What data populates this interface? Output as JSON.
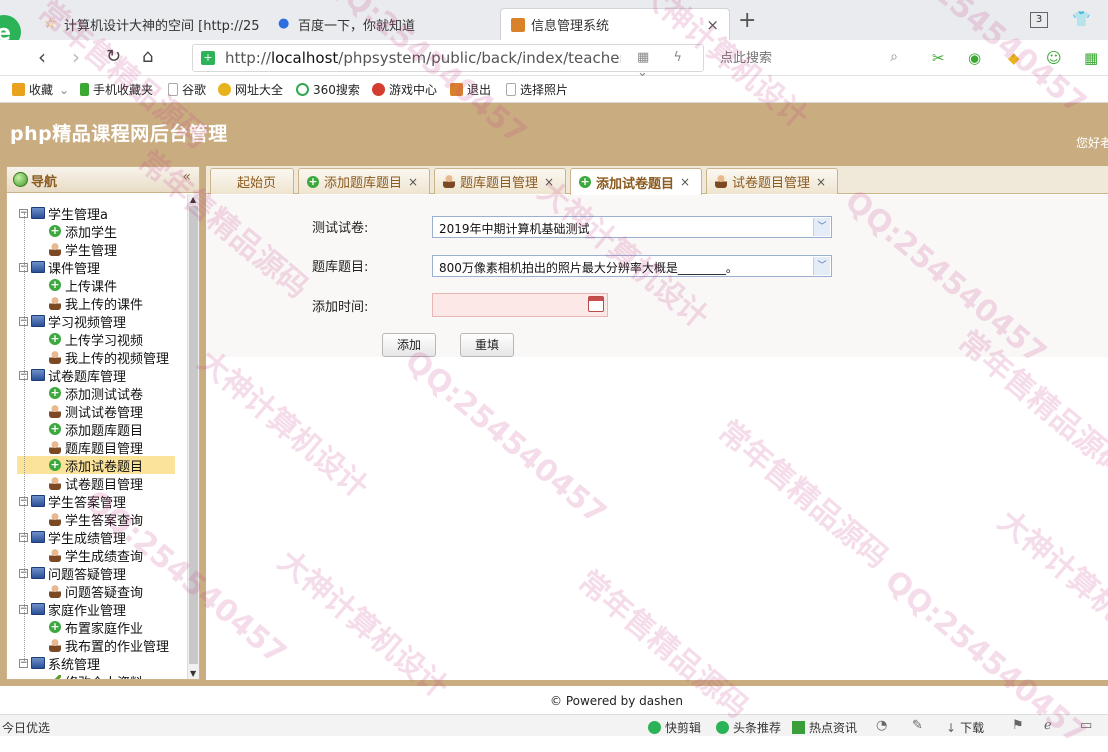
{
  "browser": {
    "tabs": [
      {
        "title": "计算机设计大神的空间 [http://25"
      },
      {
        "title": "百度一下，你就知道"
      },
      {
        "title": "信息管理系统"
      }
    ],
    "tab_count": "3",
    "url_prefix": "http://",
    "url_host": "localhost",
    "url_path": "/phpsystem/public/back/index/teacherinde",
    "search_placeholder": "点此搜索"
  },
  "bookmarks": [
    {
      "label": "收藏",
      "color": "#e8a21d"
    },
    {
      "label": "手机收藏夹",
      "color": "#3aa832"
    },
    {
      "label": "谷歌",
      "color": "#bbbbbb"
    },
    {
      "label": "网址大全",
      "color": "#e8b21d"
    },
    {
      "label": "360搜索",
      "color": "#33a852"
    },
    {
      "label": "游戏中心",
      "color": "#d33c2f"
    },
    {
      "label": "退出",
      "color": "#d9822b"
    },
    {
      "label": "选择照片",
      "color": "#bbbbbb"
    }
  ],
  "app": {
    "title": "php精品课程网后台管理",
    "greeting": "您好老",
    "footer": "© Powered by dashen"
  },
  "sidebar": {
    "title": "导航",
    "tree": [
      {
        "label": "学生管理a",
        "level": 0
      },
      {
        "label": "添加学生",
        "level": 1,
        "icon": "plus"
      },
      {
        "label": "学生管理",
        "level": 1,
        "icon": "user"
      },
      {
        "label": "课件管理",
        "level": 0
      },
      {
        "label": "上传课件",
        "level": 1,
        "icon": "plus"
      },
      {
        "label": "我上传的课件",
        "level": 1,
        "icon": "user"
      },
      {
        "label": "学习视频管理",
        "level": 0
      },
      {
        "label": "上传学习视频",
        "level": 1,
        "icon": "plus"
      },
      {
        "label": "我上传的视频管理",
        "level": 1,
        "icon": "user"
      },
      {
        "label": "试卷题库管理",
        "level": 0
      },
      {
        "label": "添加测试试卷",
        "level": 1,
        "icon": "plus"
      },
      {
        "label": "测试试卷管理",
        "level": 1,
        "icon": "user"
      },
      {
        "label": "添加题库题目",
        "level": 1,
        "icon": "plus"
      },
      {
        "label": "题库题目管理",
        "level": 1,
        "icon": "user"
      },
      {
        "label": "添加试卷题目",
        "level": 1,
        "icon": "plus",
        "selected": true
      },
      {
        "label": "试卷题目管理",
        "level": 1,
        "icon": "user"
      },
      {
        "label": "学生答案管理",
        "level": 0
      },
      {
        "label": "学生答案查询",
        "level": 1,
        "icon": "user"
      },
      {
        "label": "学生成绩管理",
        "level": 0
      },
      {
        "label": "学生成绩查询",
        "level": 1,
        "icon": "user"
      },
      {
        "label": "问题答疑管理",
        "level": 0
      },
      {
        "label": "问题答疑查询",
        "level": 1,
        "icon": "user"
      },
      {
        "label": "家庭作业管理",
        "level": 0
      },
      {
        "label": "布置家庭作业",
        "level": 1,
        "icon": "plus"
      },
      {
        "label": "我布置的作业管理",
        "level": 1,
        "icon": "user"
      },
      {
        "label": "系统管理",
        "level": 0
      },
      {
        "label": "修改个人资料",
        "level": 1,
        "icon": "pen"
      }
    ]
  },
  "content_tabs": [
    {
      "label": "起始页",
      "closable": false,
      "icon": "none"
    },
    {
      "label": "添加题库题目",
      "closable": true,
      "icon": "plus"
    },
    {
      "label": "题库题目管理",
      "closable": true,
      "icon": "user"
    },
    {
      "label": "添加试卷题目",
      "closable": true,
      "icon": "plus",
      "active": true
    },
    {
      "label": "试卷题目管理",
      "closable": true,
      "icon": "user"
    }
  ],
  "form": {
    "paper_label": "测试试卷:",
    "paper_value": "2019年中期计算机基础测试",
    "question_label": "题库题目:",
    "question_value": "800万像素相机拍出的照片最大分辨率大概是________。",
    "time_label": "添加时间:",
    "time_value": "",
    "add_button": "添加",
    "reset_button": "重填"
  },
  "status_bar": {
    "left": "今日优选",
    "items": [
      "快剪辑",
      "头条推荐",
      "热点资讯",
      "下载"
    ]
  },
  "watermarks": [
    "大神计算机设计",
    "QQ:254540457",
    "常年售精品源码"
  ]
}
